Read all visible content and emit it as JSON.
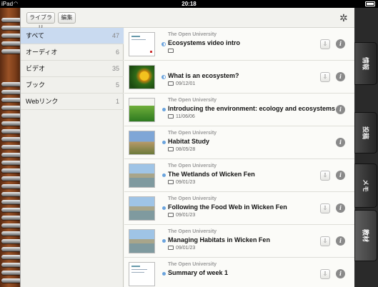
{
  "status_bar": {
    "carrier": "iPad",
    "time": "20:18"
  },
  "toolbar": {
    "library_label": "ライブラリ",
    "edit_label": "編集"
  },
  "categories": [
    {
      "label": "すべて",
      "count": "47",
      "selected": true
    },
    {
      "label": "オーディオ",
      "count": "6"
    },
    {
      "label": "ビデオ",
      "count": "35"
    },
    {
      "label": "ブック",
      "count": "5"
    },
    {
      "label": "Webリンク",
      "count": "1"
    }
  ],
  "items": [
    {
      "publisher": "The Open University",
      "title": "Ecosystems video intro",
      "date": "",
      "status": "half"
    },
    {
      "publisher": "",
      "title": "What is an ecosystem?",
      "date": "09/12/01",
      "status": "half"
    },
    {
      "publisher": "The Open University",
      "title": "Introducing the environment: ecology and ecosystems",
      "date": "11/06/06",
      "status": "new"
    },
    {
      "publisher": "The Open University",
      "title": "Habitat Study",
      "date": "08/05/28",
      "status": "new"
    },
    {
      "publisher": "The Open University",
      "title": "The Wetlands of Wicken Fen",
      "date": "09/01/23",
      "status": "new"
    },
    {
      "publisher": "The Open University",
      "title": "Following the Food Web in Wicken Fen",
      "date": "09/01/23",
      "status": "new"
    },
    {
      "publisher": "The Open University",
      "title": "Managing Habitats in Wicken Fen",
      "date": "09/01/23",
      "status": "new"
    },
    {
      "publisher": "The Open University",
      "title": "Summary of week 1",
      "date": "",
      "status": "new"
    }
  ],
  "side_tabs": [
    {
      "label": "情報"
    },
    {
      "label": "投稿"
    },
    {
      "label": "メモ"
    },
    {
      "label": "教材",
      "selected": true
    }
  ]
}
